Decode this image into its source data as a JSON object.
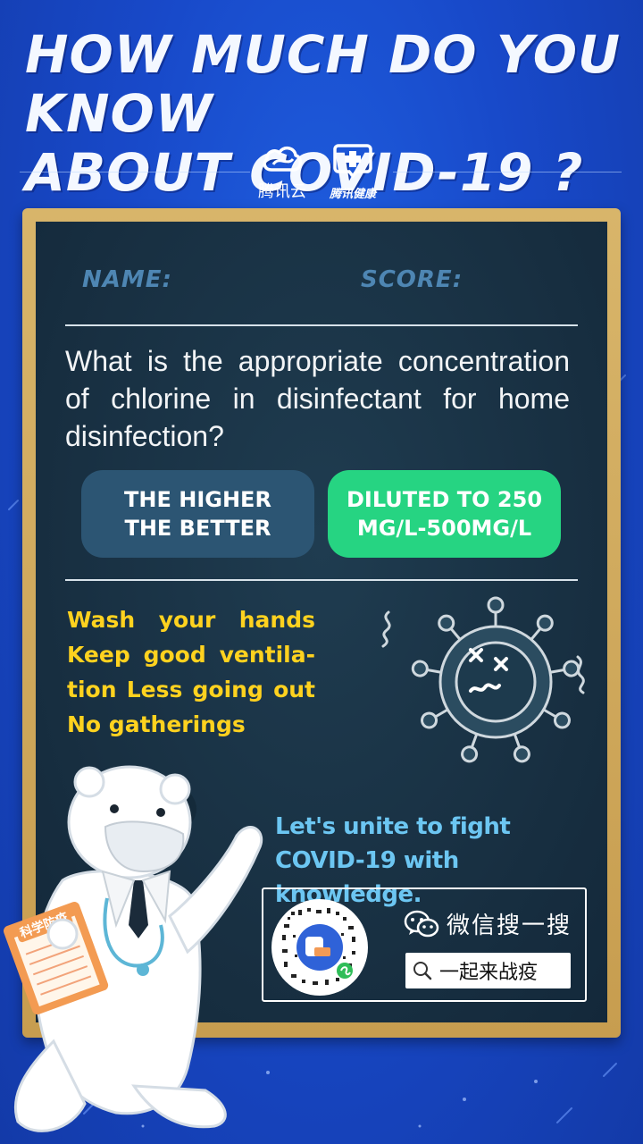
{
  "title": {
    "line1": "HOW MUCH DO YOU KNOW",
    "line2": "ABOUT COVID-19 ?"
  },
  "brands": [
    {
      "label": "腾讯云",
      "icon": "cloud-icon"
    },
    {
      "label": "腾讯健康",
      "icon": "medical-cross-icon"
    }
  ],
  "board": {
    "name_label": "NAME:",
    "score_label": "SCORE:",
    "question": "What is the appropriate concentration of chlorine in disinfectant for home disinfection?",
    "options": [
      {
        "label": "THE HIGHER THE BETTER",
        "color": "#2c5573"
      },
      {
        "label": "DILUTED TO 250 MG/L-500MG/L",
        "color": "#26d482"
      }
    ],
    "tips": "Wash your hands Keep good ventila-tion Less going out No gatherings",
    "slogan": "Let's unite to fight COVID-19 with knowledge.",
    "wechat_label": "微信搜一搜",
    "search_value": "一起来战疫",
    "clipboard_text": "科学防疫"
  },
  "colors": {
    "background": "#1849c9",
    "board": "#172e40",
    "frame": "#c79d4f",
    "tips": "#ffd21f",
    "slogan": "#6cc6f2",
    "label": "#4e86b3"
  }
}
